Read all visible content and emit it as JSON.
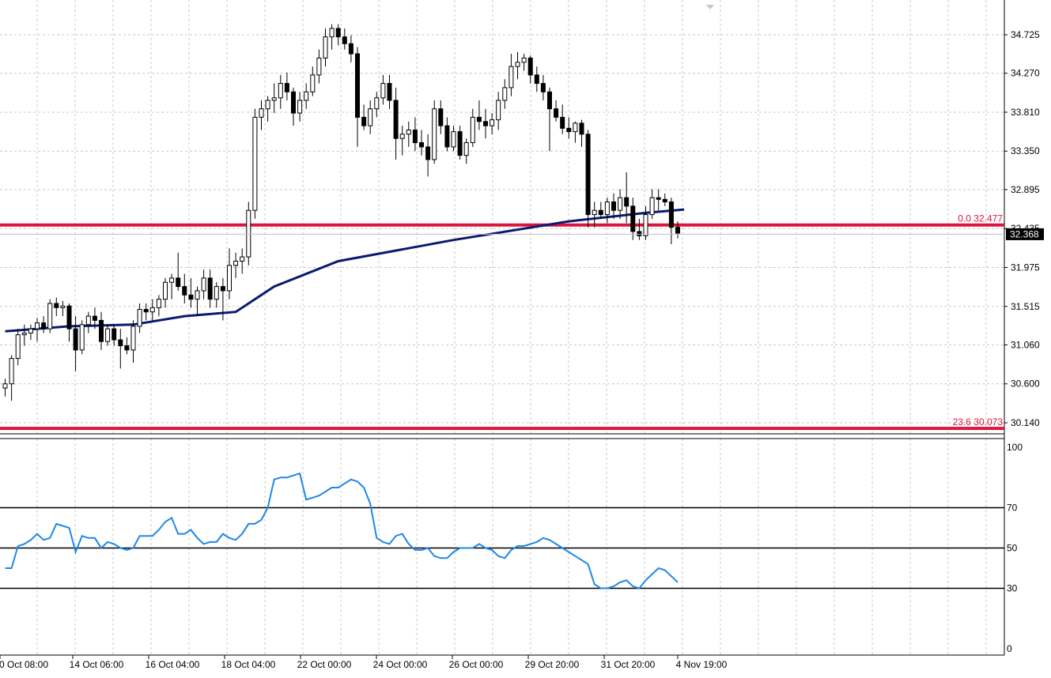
{
  "colors": {
    "background": "#ffffff",
    "grid": "#c8c8c8",
    "axis": "#000000",
    "candle_up_fill": "#ffffff",
    "candle_down_fill": "#000000",
    "moving_average": "#0a1a6e",
    "fib_line": "#dc143c",
    "rsi_line": "#1e88e5",
    "current_price_bg": "#000000",
    "current_price_text": "#ffffff"
  },
  "chart_data": [
    {
      "type": "candlestick",
      "grid": true,
      "ylim": [
        30.0,
        34.95
      ],
      "y_ticks": [
        "34.725",
        "34.270",
        "33.810",
        "33.350",
        "32.895",
        "32.435",
        "31.975",
        "31.515",
        "31.060",
        "30.600",
        "30.140"
      ],
      "current_price": "32.368",
      "fib_levels": [
        {
          "label": "0.0 32.477",
          "value": 32.477
        },
        {
          "label": "23.6 30.073",
          "value": 30.073
        }
      ],
      "ohlc": [
        [
          30.55,
          30.66,
          30.45,
          30.6
        ],
        [
          30.6,
          30.94,
          30.4,
          30.9
        ],
        [
          30.9,
          31.25,
          30.82,
          31.18
        ],
        [
          31.18,
          31.3,
          31.05,
          31.2
        ],
        [
          31.2,
          31.3,
          31.12,
          31.25
        ],
        [
          31.25,
          31.38,
          31.1,
          31.32
        ],
        [
          31.32,
          31.4,
          31.2,
          31.25
        ],
        [
          31.25,
          31.6,
          31.2,
          31.55
        ],
        [
          31.55,
          31.62,
          31.4,
          31.5
        ],
        [
          31.5,
          31.58,
          31.4,
          31.52
        ],
        [
          31.52,
          31.55,
          31.1,
          31.25
        ],
        [
          31.25,
          31.4,
          30.75,
          31.0
        ],
        [
          31.0,
          31.35,
          30.95,
          31.3
        ],
        [
          31.3,
          31.45,
          31.2,
          31.4
        ],
        [
          31.4,
          31.5,
          31.25,
          31.35
        ],
        [
          31.35,
          31.45,
          31.0,
          31.1
        ],
        [
          31.1,
          31.3,
          31.05,
          31.25
        ],
        [
          31.25,
          31.3,
          31.05,
          31.12
        ],
        [
          31.12,
          31.25,
          30.78,
          31.05
        ],
        [
          31.05,
          31.15,
          30.95,
          31.0
        ],
        [
          31.0,
          31.35,
          30.85,
          31.28
        ],
        [
          31.28,
          31.55,
          31.2,
          31.48
        ],
        [
          31.48,
          31.55,
          31.35,
          31.45
        ],
        [
          31.45,
          31.6,
          31.35,
          31.5
        ],
        [
          31.5,
          31.65,
          31.4,
          31.6
        ],
        [
          31.6,
          31.85,
          31.5,
          31.8
        ],
        [
          31.8,
          31.9,
          31.6,
          31.85
        ],
        [
          31.85,
          32.15,
          31.7,
          31.75
        ],
        [
          31.75,
          31.9,
          31.55,
          31.65
        ],
        [
          31.65,
          31.85,
          31.5,
          31.6
        ],
        [
          31.6,
          31.75,
          31.4,
          31.7
        ],
        [
          31.7,
          31.95,
          31.6,
          31.85
        ],
        [
          31.85,
          31.95,
          31.5,
          31.6
        ],
        [
          31.6,
          31.8,
          31.5,
          31.75
        ],
        [
          31.75,
          31.85,
          31.35,
          31.7
        ],
        [
          31.7,
          32.2,
          31.6,
          32.0
        ],
        [
          32.0,
          32.15,
          31.85,
          32.05
        ],
        [
          32.05,
          32.2,
          31.9,
          32.1
        ],
        [
          32.1,
          32.75,
          32.0,
          32.65
        ],
        [
          32.65,
          33.85,
          32.55,
          33.75
        ],
        [
          33.75,
          33.95,
          33.6,
          33.85
        ],
        [
          33.85,
          34.0,
          33.7,
          33.95
        ],
        [
          33.95,
          34.15,
          33.8,
          33.98
        ],
        [
          33.98,
          34.25,
          33.85,
          34.15
        ],
        [
          34.15,
          34.28,
          33.95,
          34.05
        ],
        [
          34.05,
          34.1,
          33.65,
          33.8
        ],
        [
          33.8,
          34.05,
          33.7,
          33.95
        ],
        [
          33.95,
          34.15,
          33.85,
          34.05
        ],
        [
          34.05,
          34.35,
          34.0,
          34.25
        ],
        [
          34.25,
          34.55,
          34.15,
          34.45
        ],
        [
          34.45,
          34.8,
          34.35,
          34.7
        ],
        [
          34.7,
          34.85,
          34.55,
          34.8
        ],
        [
          34.8,
          34.85,
          34.6,
          34.7
        ],
        [
          34.7,
          34.8,
          34.55,
          34.62
        ],
        [
          34.62,
          34.72,
          34.4,
          34.5
        ],
        [
          34.5,
          34.58,
          33.4,
          33.75
        ],
        [
          33.75,
          33.9,
          33.6,
          33.65
        ],
        [
          33.65,
          33.95,
          33.55,
          33.85
        ],
        [
          33.85,
          34.05,
          33.75,
          33.98
        ],
        [
          33.98,
          34.25,
          33.9,
          34.15
        ],
        [
          34.15,
          34.25,
          33.85,
          33.95
        ],
        [
          33.95,
          34.1,
          33.25,
          33.5
        ],
        [
          33.5,
          33.65,
          33.3,
          33.55
        ],
        [
          33.55,
          33.7,
          33.4,
          33.6
        ],
        [
          33.6,
          33.75,
          33.35,
          33.45
        ],
        [
          33.45,
          33.6,
          33.3,
          33.4
        ],
        [
          33.4,
          33.55,
          33.05,
          33.25
        ],
        [
          33.25,
          33.95,
          33.2,
          33.85
        ],
        [
          33.85,
          33.95,
          33.55,
          33.65
        ],
        [
          33.65,
          33.75,
          33.35,
          33.4
        ],
        [
          33.4,
          33.65,
          33.35,
          33.58
        ],
        [
          33.58,
          33.65,
          33.25,
          33.3
        ],
        [
          33.3,
          33.5,
          33.2,
          33.45
        ],
        [
          33.45,
          33.85,
          33.4,
          33.75
        ],
        [
          33.75,
          33.95,
          33.6,
          33.7
        ],
        [
          33.7,
          33.85,
          33.5,
          33.65
        ],
        [
          33.65,
          33.8,
          33.55,
          33.72
        ],
        [
          33.72,
          34.05,
          33.6,
          33.95
        ],
        [
          33.95,
          34.2,
          33.85,
          34.1
        ],
        [
          34.1,
          34.5,
          34.0,
          34.35
        ],
        [
          34.35,
          34.52,
          34.2,
          34.4
        ],
        [
          34.4,
          34.5,
          34.3,
          34.45
        ],
        [
          34.45,
          34.48,
          34.15,
          34.25
        ],
        [
          34.25,
          34.35,
          34.05,
          34.15
        ],
        [
          34.15,
          34.25,
          33.95,
          34.05
        ],
        [
          34.05,
          34.1,
          33.35,
          33.85
        ],
        [
          33.85,
          33.95,
          33.7,
          33.75
        ],
        [
          33.75,
          33.9,
          33.55,
          33.62
        ],
        [
          33.62,
          33.75,
          33.5,
          33.58
        ],
        [
          33.58,
          33.7,
          33.45,
          33.68
        ],
        [
          33.68,
          33.72,
          33.4,
          33.55
        ],
        [
          33.55,
          33.6,
          32.45,
          32.6
        ],
        [
          32.6,
          32.75,
          32.45,
          32.65
        ],
        [
          32.65,
          32.75,
          32.55,
          32.6
        ],
        [
          32.6,
          32.8,
          32.5,
          32.75
        ],
        [
          32.75,
          32.85,
          32.55,
          32.65
        ],
        [
          32.65,
          32.9,
          32.55,
          32.8
        ],
        [
          32.8,
          33.1,
          32.5,
          32.7
        ],
        [
          32.7,
          32.8,
          32.3,
          32.4
        ],
        [
          32.4,
          32.55,
          32.3,
          32.35
        ],
        [
          32.35,
          32.7,
          32.3,
          32.6
        ],
        [
          32.6,
          32.9,
          32.55,
          32.8
        ],
        [
          32.8,
          32.9,
          32.65,
          32.78
        ],
        [
          32.78,
          32.85,
          32.7,
          32.75
        ],
        [
          32.75,
          32.8,
          32.25,
          32.45
        ],
        [
          32.45,
          32.52,
          32.32,
          32.38
        ]
      ],
      "moving_average": {
        "name": "",
        "x": [
          0,
          5,
          10,
          20,
          28,
          36,
          42,
          52,
          70,
          88,
          100,
          106
        ],
        "values": [
          31.22,
          31.25,
          31.28,
          31.3,
          31.4,
          31.45,
          31.75,
          32.05,
          32.3,
          32.52,
          32.62,
          32.66
        ]
      }
    },
    {
      "type": "line",
      "grid": true,
      "ylim": [
        0,
        100
      ],
      "y_ticks": [
        "100",
        "0"
      ],
      "level_lines": [
        {
          "label": "70",
          "value": 70
        },
        {
          "label": "50",
          "value": 50
        },
        {
          "label": "30",
          "value": 30
        }
      ],
      "series": [
        {
          "values": [
            40,
            40,
            51,
            52,
            54,
            57,
            54,
            55,
            62,
            61,
            60,
            48,
            56,
            55,
            55,
            50,
            53,
            52,
            50,
            49,
            50,
            56,
            56,
            56,
            59,
            63,
            65,
            57,
            57,
            59,
            55,
            52,
            53,
            53,
            57,
            55,
            54,
            57,
            62,
            62,
            64,
            70,
            84,
            85,
            85,
            86,
            87,
            74,
            75,
            76,
            78,
            80,
            80,
            82,
            84,
            83,
            80,
            72,
            55,
            53,
            52,
            56,
            57,
            52,
            49,
            49,
            50,
            46,
            45,
            45,
            48,
            50,
            50,
            50,
            52,
            50,
            49,
            46,
            45,
            49,
            51,
            51,
            52,
            53,
            55,
            54,
            52,
            50,
            48,
            46,
            44,
            42,
            32,
            30,
            30,
            31,
            33,
            34,
            31,
            30,
            34,
            37,
            40,
            39,
            36,
            33
          ]
        }
      ]
    }
  ],
  "x_axis": {
    "labels": [
      "0 Oct 08:00",
      "14 Oct 06:00",
      "16 Oct 04:00",
      "18 Oct 04:00",
      "22 Oct 00:00",
      "24 Oct 00:00",
      "26 Oct 00:00",
      "29 Oct 20:00",
      "31 Oct 20:00",
      "4 Nov 19:00"
    ]
  }
}
